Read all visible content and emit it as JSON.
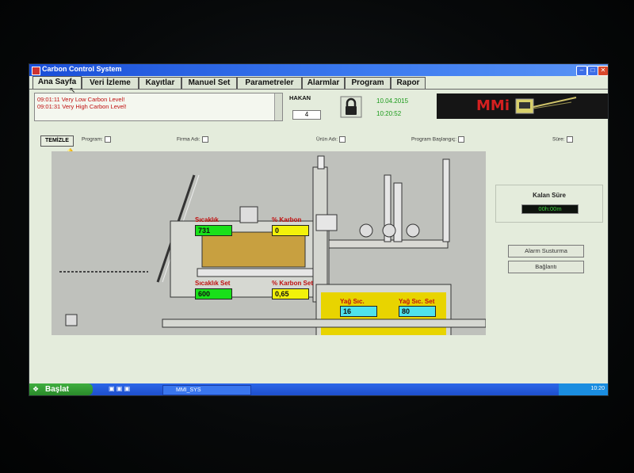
{
  "window": {
    "title": "Carbon Control System"
  },
  "tabs": [
    {
      "label": "Ana Sayfa",
      "active": true
    },
    {
      "label": "Veri İzleme",
      "active": false
    },
    {
      "label": "Kayıtlar",
      "active": false
    },
    {
      "label": "Manuel Set",
      "active": false
    },
    {
      "label": "Parametreler",
      "active": false
    },
    {
      "label": "Alarmlar",
      "active": false
    },
    {
      "label": "Program",
      "active": false
    },
    {
      "label": "Rapor",
      "active": false
    }
  ],
  "alarms": [
    {
      "text": "09:01:11 Very Low Carbon Level!"
    },
    {
      "text": "09:01:31 Very High Carbon Level!"
    }
  ],
  "user": {
    "name": "HAKAN",
    "level": "4"
  },
  "datetime": {
    "date": "10.04.2015",
    "time": "10:20:52"
  },
  "logo": {
    "brand": "MMi"
  },
  "filters": {
    "clear_label": "TEMİZLE",
    "program": "Program:",
    "firm_name": "Firma Adı:",
    "product_name": "Ürün Adı:",
    "program_start": "Program Başlangıç:",
    "duration": "Süre:"
  },
  "process": {
    "temperature_label": "Sıcaklık",
    "temperature_value": "731",
    "carbon_label": "% Karbon",
    "carbon_value": "0",
    "temperature_set_label": "Sıcaklık Set",
    "temperature_set_value": "600",
    "carbon_set_label": "% Karbon Set",
    "carbon_set_value": "0,65",
    "oil_temp_label": "Yağ Sıc.",
    "oil_temp_value": "16",
    "oil_temp_set_label": "Yağ Sıc. Set",
    "oil_temp_set_value": "80"
  },
  "remaining": {
    "label": "Kalan Süre",
    "value": "00h:00m"
  },
  "buttons": {
    "alarm_silence": "Alarm Susturma",
    "connection": "Bağlantı"
  },
  "taskbar": {
    "start_label": "Başlat",
    "task_label": "MMI_SYS",
    "clock": "10:20"
  },
  "colors": {
    "temperature_green": "#19e019",
    "carbon_yellow": "#f2f20a",
    "oil_cyan": "#4fe2ec",
    "oil_fill": "#e8d400",
    "alarm_red": "#c01010"
  }
}
